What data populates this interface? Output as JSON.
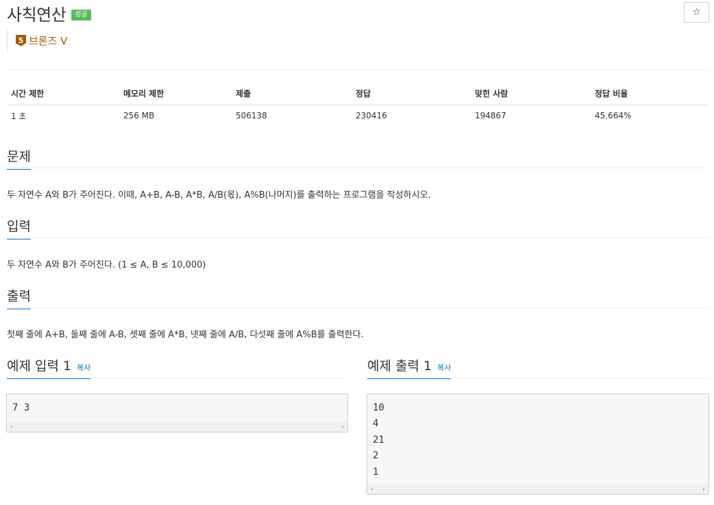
{
  "problem": {
    "title": "사칙연산",
    "status_badge": "성공",
    "star_icon": "☆",
    "tier": {
      "level": "5",
      "label": "브론즈 V",
      "color": "#ad5600"
    }
  },
  "info_table": {
    "headers": [
      "시간 제한",
      "메모리 제한",
      "제출",
      "정답",
      "맞힌 사람",
      "정답 비율"
    ],
    "values": [
      "1 초",
      "256 MB",
      "506138",
      "230416",
      "194867",
      "45.664%"
    ]
  },
  "sections": {
    "description": {
      "heading": "문제",
      "text": "두 자연수 A와 B가 주어진다. 이때, A+B, A-B, A*B, A/B(몫), A%B(나머지)를 출력하는 프로그램을 작성하시오."
    },
    "input": {
      "heading": "입력",
      "text": "두 자연수 A와 B가 주어진다. (1 ≤ A, B ≤ 10,000)"
    },
    "output": {
      "heading": "출력",
      "text": "첫째 줄에 A+B, 둘째 줄에 A-B, 셋째 줄에 A*B, 넷째 줄에 A/B, 다섯째 줄에 A%B를 출력한다."
    }
  },
  "samples": {
    "input": {
      "heading": "예제 입력 1",
      "copy_label": "복사",
      "lines": [
        "7 3"
      ]
    },
    "output": {
      "heading": "예제 출력 1",
      "copy_label": "복사",
      "lines": [
        "10",
        "4",
        "21",
        "2",
        "1"
      ]
    }
  },
  "icons": {
    "scroll_left": "◂",
    "scroll_right": "▸"
  },
  "colors": {
    "success": "#5cb85c",
    "bronze": "#ad5600",
    "link": "#0076c0"
  }
}
